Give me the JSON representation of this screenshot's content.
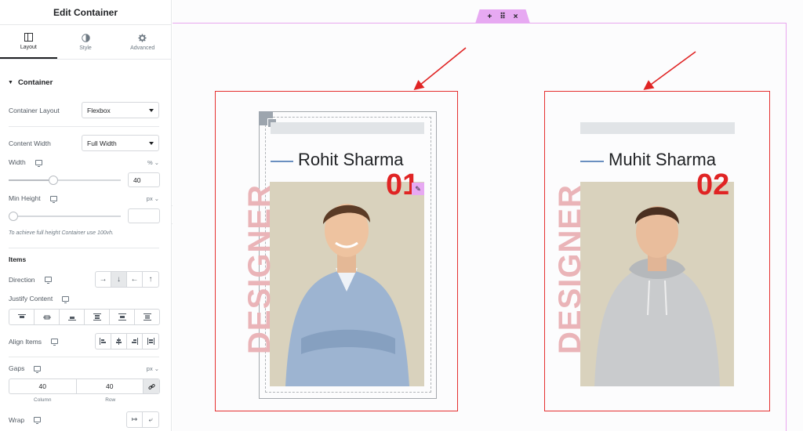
{
  "panel": {
    "title": "Edit Container",
    "tabs": [
      {
        "label": "Layout",
        "icon": "layout-icon"
      },
      {
        "label": "Style",
        "icon": "half-circle-icon"
      },
      {
        "label": "Advanced",
        "icon": "gear-icon"
      }
    ],
    "section": "Container",
    "container_layout": {
      "label": "Container Layout",
      "value": "Flexbox"
    },
    "content_width": {
      "label": "Content Width",
      "value": "Full Width"
    },
    "width": {
      "label": "Width",
      "unit": "%",
      "value": "40",
      "slider_fraction": 0.4
    },
    "min_height": {
      "label": "Min Height",
      "unit": "px",
      "value": "",
      "slider_fraction": 0
    },
    "hint": "To achieve full height Container use 100vh.",
    "items_title": "Items",
    "direction": {
      "label": "Direction",
      "options": [
        "→",
        "↓",
        "←",
        "↑"
      ],
      "selected": 1
    },
    "justify_content": {
      "label": "Justify Content"
    },
    "align_items": {
      "label": "Align Items"
    },
    "gaps": {
      "label": "Gaps",
      "unit": "px",
      "column": "40",
      "row": "40",
      "column_label": "Column",
      "row_label": "Row"
    },
    "wrap": {
      "label": "Wrap"
    }
  },
  "canvas": {
    "handle_icons": [
      "+",
      "⠿",
      "×"
    ],
    "cards": [
      {
        "name": "Rohit Sharma",
        "number": "01",
        "role": "DESIGNER"
      },
      {
        "name": "Muhit Sharma",
        "number": "02",
        "role": "DESIGNER"
      }
    ],
    "colors": {
      "accent_red": "#e02424",
      "highlight_pink": "#e7a9f2",
      "vertical_text": "#eab4b8"
    }
  }
}
